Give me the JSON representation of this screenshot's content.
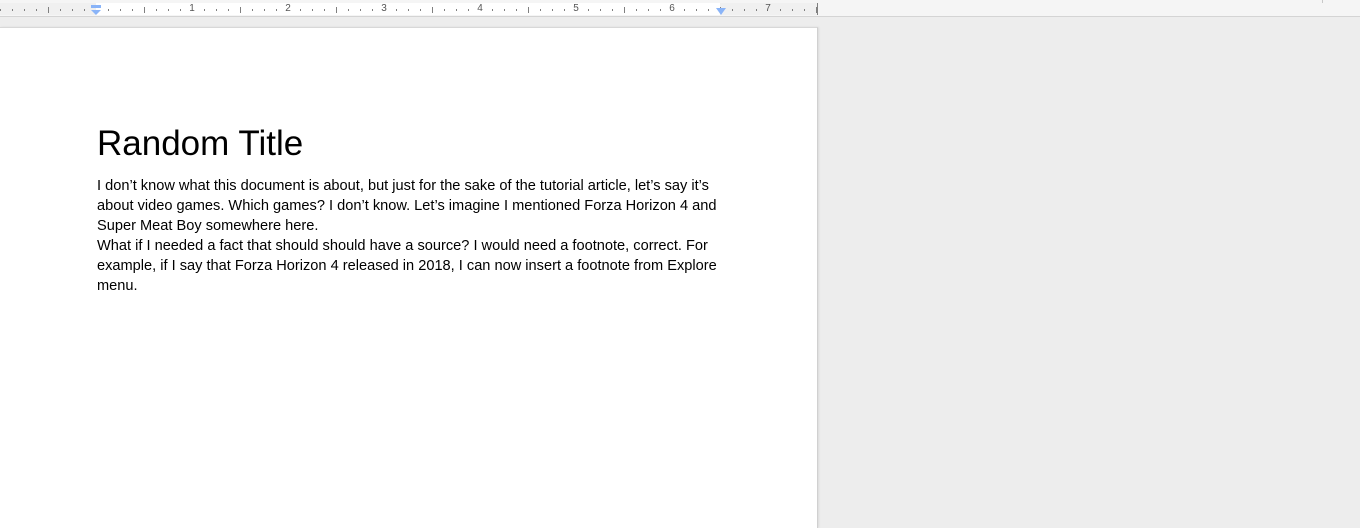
{
  "ruler": {
    "numbers": [
      "1",
      "2",
      "3",
      "4",
      "5",
      "6",
      "7"
    ]
  },
  "document": {
    "title": "Random Title",
    "paragraphs": [
      "I don’t know what this document is about, but just for the sake of the tutorial article, let’s say it’s about video games. Which games? I don’t know. Let’s imagine I mentioned Forza Horizon 4 and Super Meat Boy somewhere here.",
      "What if I needed a fact that should should have a source? I would need a footnote, correct. For example, if I say that Forza Horizon 4 released in 2018, I can now insert a footnote from Explore menu."
    ]
  },
  "colors": {
    "workspace": "#ededed",
    "page": "#ffffff",
    "indent_marker": "#8ab4f8"
  },
  "icons": {
    "left_indent": "first-line-indent-icon",
    "right_indent": "right-indent-icon"
  }
}
